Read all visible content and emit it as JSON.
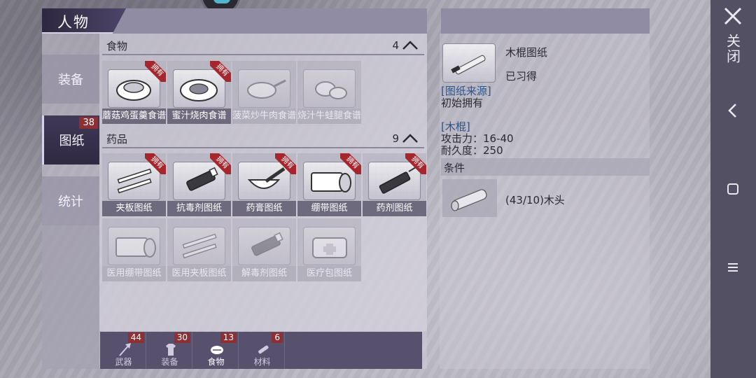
{
  "window": {
    "title": "人物"
  },
  "side_tabs": [
    {
      "label": "装备",
      "count": ""
    },
    {
      "label": "图纸",
      "count": "38"
    },
    {
      "label": "统计",
      "count": ""
    }
  ],
  "sections": {
    "food": {
      "title": "食物",
      "count": "4"
    },
    "medicine": {
      "title": "药品",
      "count": "9"
    }
  },
  "owned_tag": "拥有",
  "food_items": [
    {
      "label": "蘑菇鸡蛋羹食谱",
      "owned": true,
      "icon": "bowl-icon"
    },
    {
      "label": "蜜汁烧肉食谱",
      "owned": true,
      "icon": "plate-icon"
    },
    {
      "label": "菠菜炒牛肉食谱",
      "owned": false,
      "icon": "pan-icon"
    },
    {
      "label": "烧汁牛蛙腿食谱",
      "owned": false,
      "icon": "meat-icon"
    }
  ],
  "medicine_items": [
    {
      "label": "夹板图纸",
      "owned": true,
      "icon": "splint-icon"
    },
    {
      "label": "抗毒剂图纸",
      "owned": true,
      "icon": "vial-icon"
    },
    {
      "label": "药膏图纸",
      "owned": true,
      "icon": "mortar-icon"
    },
    {
      "label": "绷带图纸",
      "owned": true,
      "icon": "bandage-icon"
    },
    {
      "label": "药剂图纸",
      "owned": true,
      "icon": "syringe-icon"
    },
    {
      "label": "医用绷带图纸",
      "owned": false,
      "icon": "bandage-icon"
    },
    {
      "label": "医用夹板图纸",
      "owned": false,
      "icon": "splint-icon"
    },
    {
      "label": "解毒剂图纸",
      "owned": false,
      "icon": "vial-icon"
    },
    {
      "label": "医疗包图纸",
      "owned": false,
      "icon": "medkit-icon"
    }
  ],
  "bottom_tabs": [
    {
      "label": "武器",
      "count": "44",
      "icon": "axe-icon",
      "active": false
    },
    {
      "label": "装备",
      "count": "30",
      "icon": "shirt-icon",
      "active": false
    },
    {
      "label": "食物",
      "count": "13",
      "icon": "steak-icon",
      "active": true
    },
    {
      "label": "材料",
      "count": "6",
      "icon": "log-icon",
      "active": false
    }
  ],
  "detail": {
    "name": "木棍图纸",
    "status": "已习得",
    "source_label": "[图纸来源]",
    "source_value": "初始拥有",
    "item_label": "[木棍]",
    "attack": "攻击力：16-40",
    "durability": "耐久度：250",
    "condition_title": "条件",
    "condition_value": "(43/10)木头"
  },
  "system_nav": {
    "close_label": "关闭",
    "back_icon": "chevron-left-icon",
    "home_icon": "square-icon",
    "menu_icon": "menu-icon"
  }
}
